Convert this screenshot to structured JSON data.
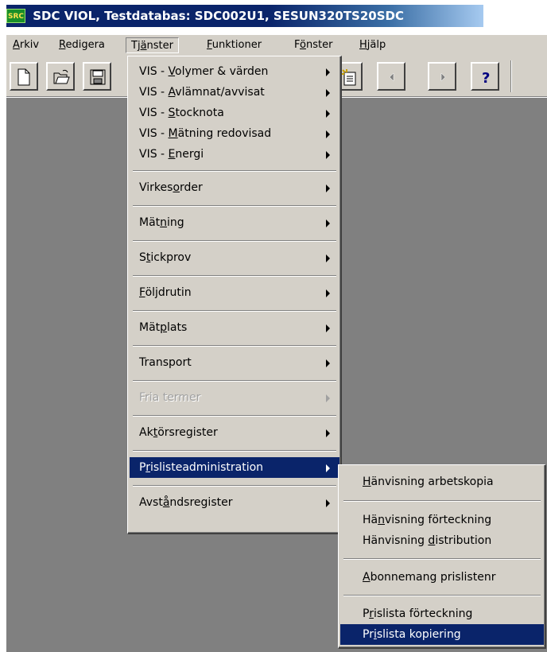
{
  "window": {
    "logo_text": "SRC",
    "title": "SDC VIOL, Testdatabas: SDC002U1, SESUN320TS20SDC"
  },
  "menubar": [
    {
      "pre": "",
      "u": "A",
      "post": "rkiv"
    },
    {
      "pre": "",
      "u": "R",
      "post": "edigera"
    },
    {
      "pre": "Tj",
      "u": "ä",
      "post": "nster"
    },
    {
      "pre": "",
      "u": "F",
      "post": "unktioner"
    },
    {
      "pre": "F",
      "u": "ö",
      "post": "nster"
    },
    {
      "pre": "",
      "u": "H",
      "post": "jälp"
    }
  ],
  "toolbar": {
    "buttons": [
      "new-document-icon",
      "open-folder-icon",
      "save-disk-icon",
      "new-record-icon",
      "previous-icon",
      "next-icon",
      "help-icon"
    ],
    "help_glyph": "?"
  },
  "tjanster_menu": [
    {
      "pre": "VIS - ",
      "u": "V",
      "post": "olymer & värden"
    },
    {
      "pre": "VIS - ",
      "u": "A",
      "post": "vlämnat/avvisat"
    },
    {
      "pre": "VIS - ",
      "u": "S",
      "post": "tocknota"
    },
    {
      "pre": "VIS - ",
      "u": "M",
      "post": "ätning redovisad"
    },
    {
      "pre": "VIS - ",
      "u": "E",
      "post": "nergi"
    },
    {
      "pre": "Virkes",
      "u": "o",
      "post": "rder"
    },
    {
      "pre": "Mät",
      "u": "n",
      "post": "ing"
    },
    {
      "pre": "S",
      "u": "t",
      "post": "ickprov"
    },
    {
      "pre": "",
      "u": "F",
      "post": "öljdrutin"
    },
    {
      "pre": "Mät",
      "u": "p",
      "post": "lats"
    },
    {
      "pre": "Transport",
      "u": "",
      "post": ""
    },
    {
      "pre": "Fria termer",
      "u": "",
      "post": ""
    },
    {
      "pre": "Ak",
      "u": "t",
      "post": "örsregister"
    },
    {
      "pre": "P",
      "u": "r",
      "post": "islisteadministration"
    },
    {
      "pre": "Avst",
      "u": "å",
      "post": "ndsregister"
    }
  ],
  "prislista_submenu": [
    {
      "pre": "",
      "u": "H",
      "post": "änvisning arbetskopia"
    },
    {
      "pre": "Hä",
      "u": "n",
      "post": "visning förteckning"
    },
    {
      "pre": "Hänvisning ",
      "u": "d",
      "post": "istribution"
    },
    {
      "pre": "",
      "u": "A",
      "post": "bonnemang prislistenr"
    },
    {
      "pre": "P",
      "u": "r",
      "post": "islista förteckning"
    },
    {
      "pre": "Pr",
      "u": "i",
      "post": "slista kopiering"
    }
  ],
  "colors": {
    "menu_face": "#d4d0c8",
    "highlight": "#0a246a",
    "workspace": "#808080"
  }
}
